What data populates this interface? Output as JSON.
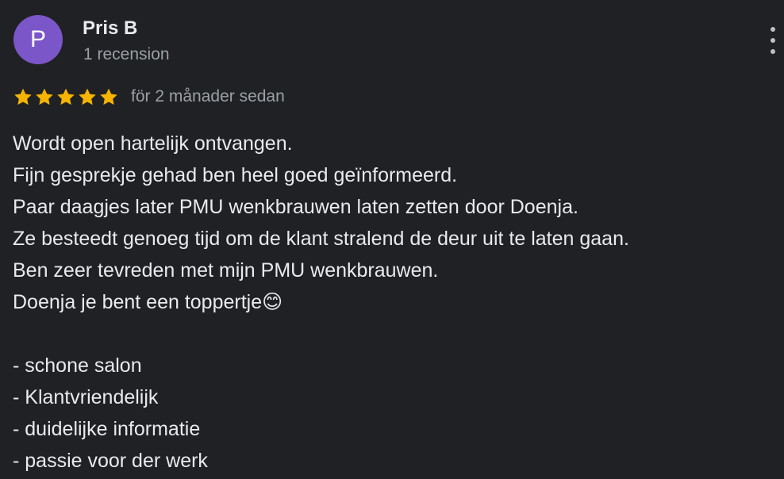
{
  "reviewer": {
    "avatar_initial": "P",
    "avatar_color": "#7b56c9",
    "name": "Pris B",
    "review_count": "1 recension"
  },
  "rating": {
    "stars": 5,
    "max_stars": 5,
    "star_color": "#f4b400",
    "time_ago": "för 2 månader sedan"
  },
  "menu": {
    "icon": "more-vert-icon"
  },
  "review": {
    "lines": [
      "Wordt open hartelijk ontvangen.",
      "Fijn gesprekje gehad ben heel goed geïnformeerd.",
      "Paar daagjes later PMU wenkbrauwen laten zetten door Doenja.",
      "Ze besteedt genoeg tijd om de klant stralend de deur uit te laten gaan.",
      "Ben zeer tevreden met mijn PMU wenkbrauwen.",
      "Doenja je bent een toppertje😊",
      "",
      "- schone salon",
      "- Klantvriendelijk",
      "- duidelijke informatie",
      "- passie voor der werk"
    ]
  }
}
